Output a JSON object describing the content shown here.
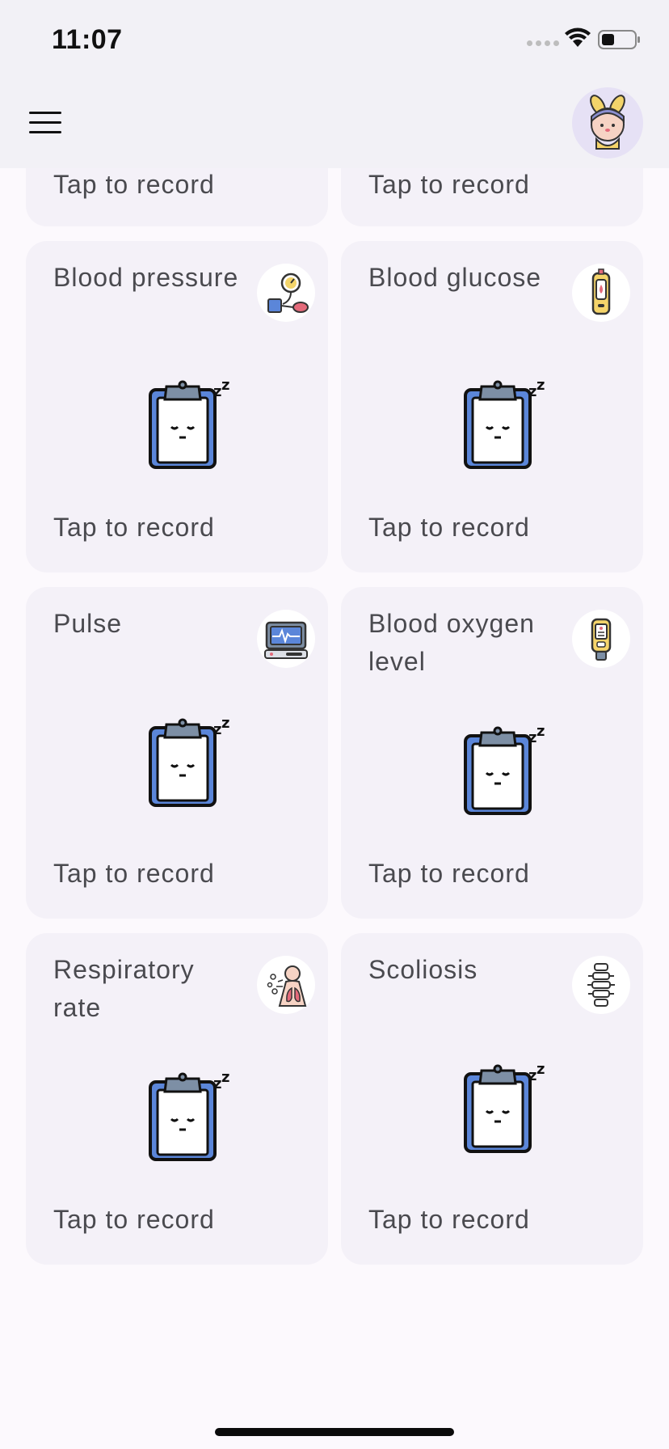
{
  "status_bar": {
    "time": "11:07"
  },
  "cards": [
    {
      "id": "top-left-partial",
      "action": "Tap to record"
    },
    {
      "id": "top-right-partial",
      "action": "Tap to record"
    },
    {
      "id": "blood-pressure",
      "title": "Blood pressure",
      "icon": "blood-pressure-monitor-icon",
      "action": "Tap to record"
    },
    {
      "id": "blood-glucose",
      "title": "Blood glucose",
      "icon": "glucose-meter-icon",
      "action": "Tap to record"
    },
    {
      "id": "pulse",
      "title": "Pulse",
      "icon": "ecg-monitor-icon",
      "action": "Tap to record"
    },
    {
      "id": "blood-oxygen",
      "title": "Blood oxygen level",
      "icon": "pulse-oximeter-icon",
      "action": "Tap to record"
    },
    {
      "id": "respiratory-rate",
      "title": "Respiratory rate",
      "icon": "lungs-breathing-icon",
      "action": "Tap to record"
    },
    {
      "id": "scoliosis",
      "title": "Scoliosis",
      "icon": "spine-icon",
      "action": "Tap to record"
    }
  ],
  "colors": {
    "background": "#fcf9fd",
    "card": "#f4f1f8",
    "header": "#f2f1f6",
    "clipboard_blue": "#5b86d9",
    "text": "#4a4a4f"
  }
}
